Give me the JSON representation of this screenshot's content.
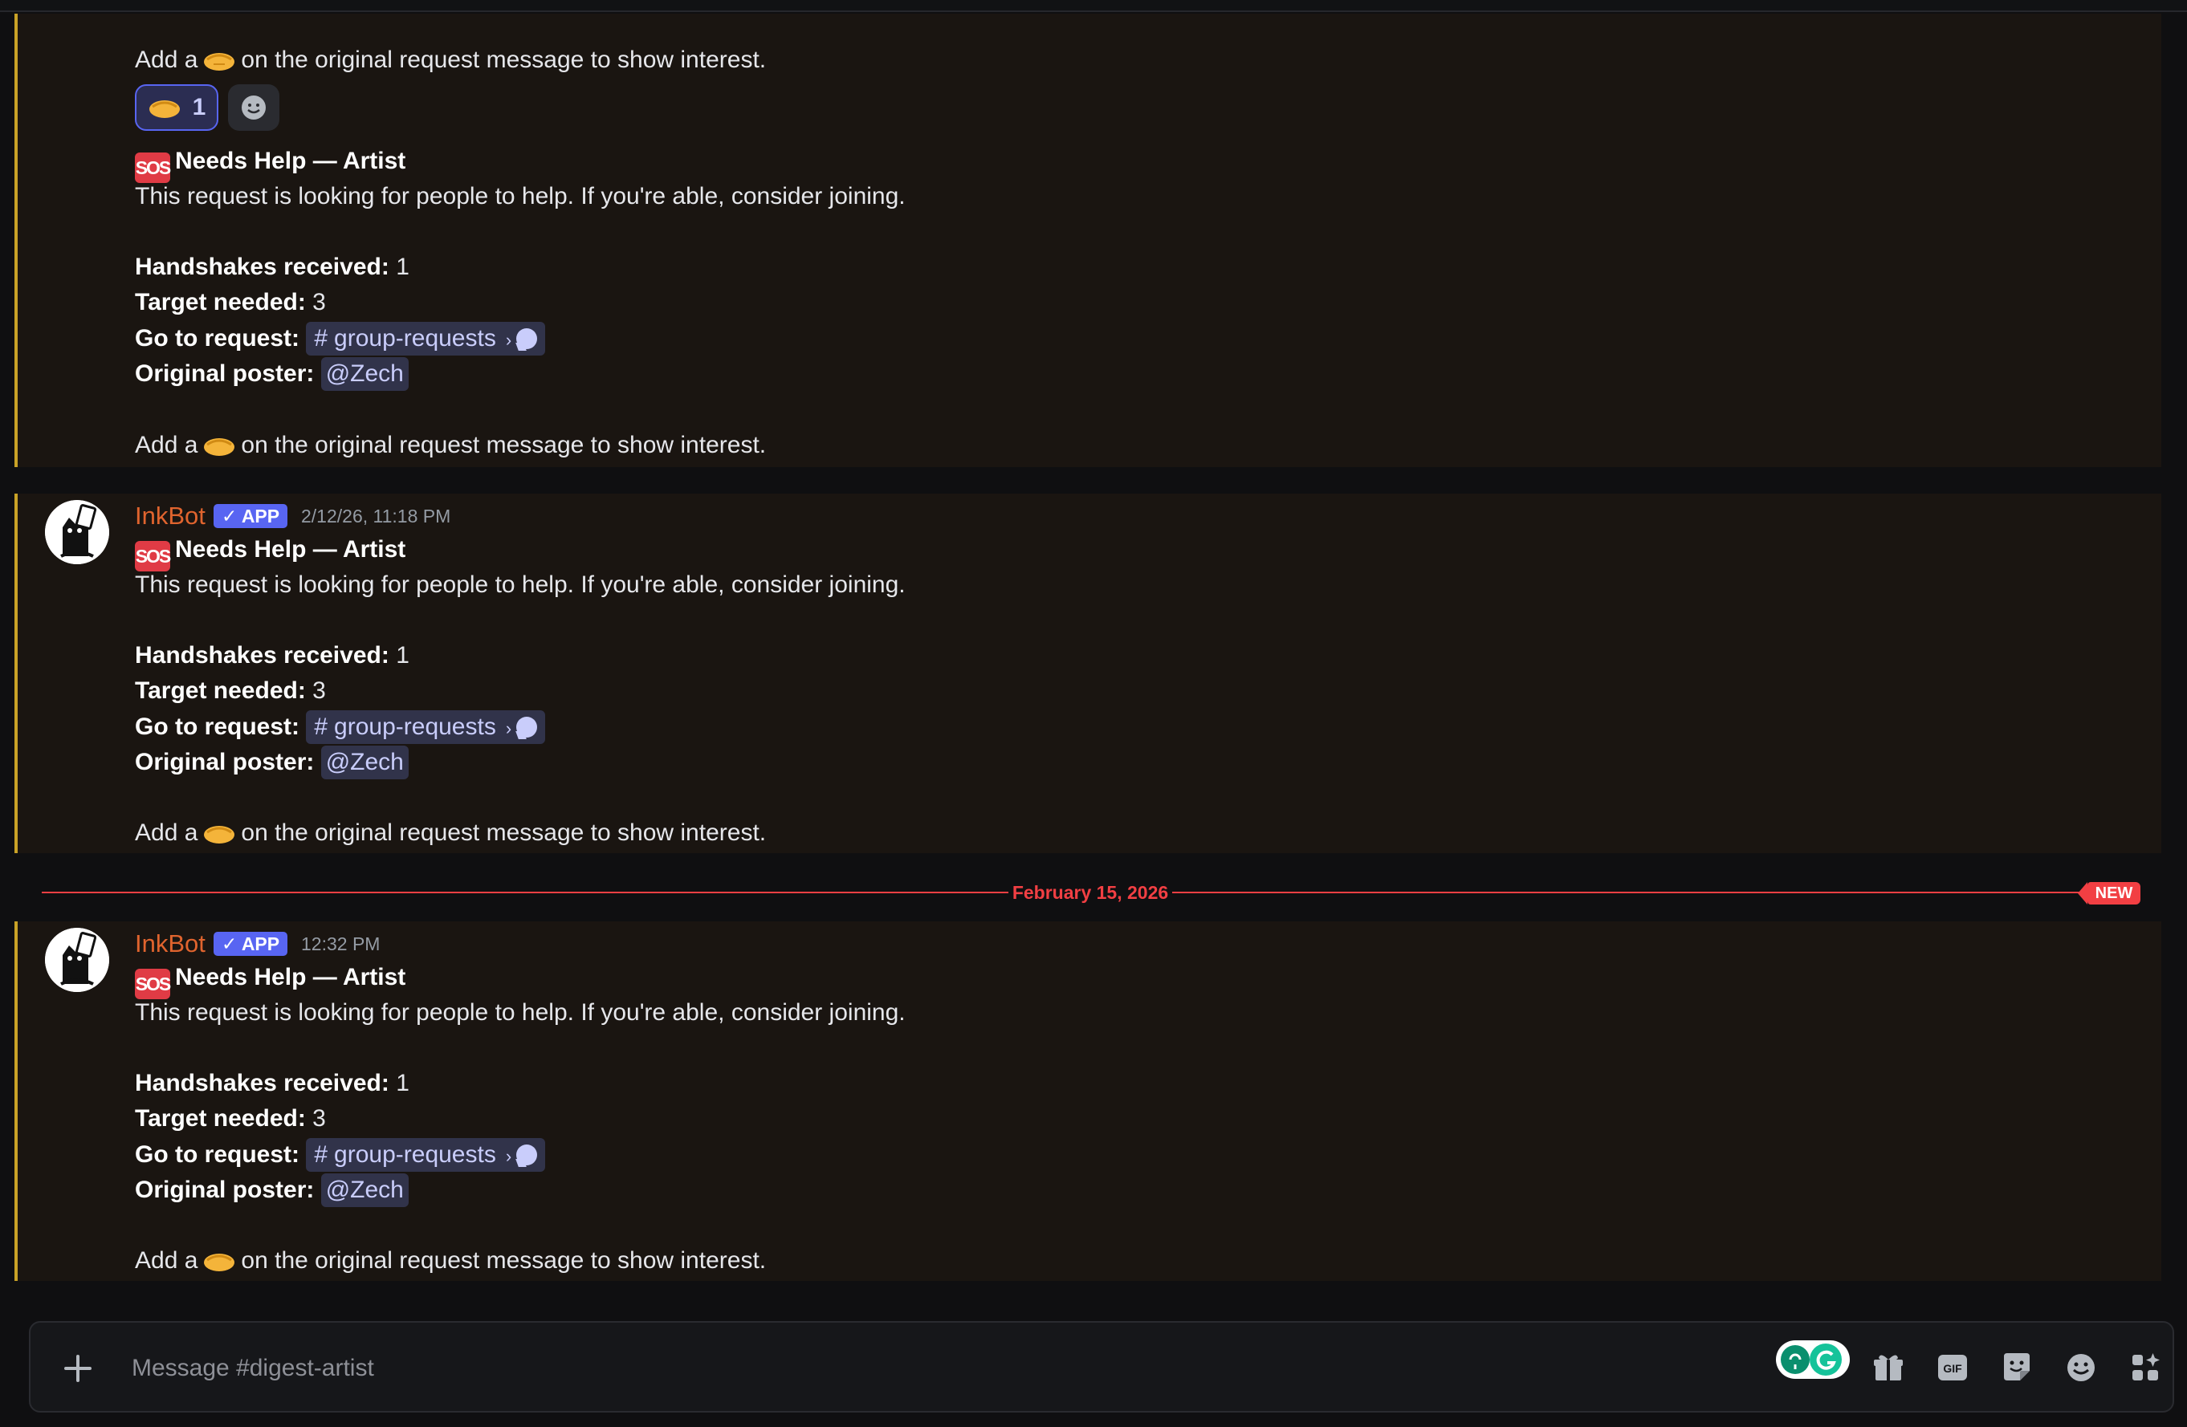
{
  "messages": {
    "m0": {
      "interest_prefix": "Add a",
      "interest_suffix": "on the original request message to show interest.",
      "reaction_count": "1"
    },
    "m1": {
      "sos": "SOS",
      "title": "Needs Help — Artist",
      "desc": "This request is looking for people to help. If you're able, consider joining.",
      "handshakes_label": "Handshakes received:",
      "handshakes_value": "1",
      "target_label": "Target needed:",
      "target_value": "3",
      "goto_label": "Go to request:",
      "channel_hash": "#",
      "channel": "group-requests",
      "channel_chevron": "›",
      "poster_label": "Original poster:",
      "poster": "@Zech",
      "interest_prefix": "Add a",
      "interest_suffix": "on the original request message to show interest."
    },
    "m2": {
      "author": "InkBot",
      "badge": "APP",
      "time": "2/12/26, 11:18 PM",
      "sos": "SOS",
      "title": "Needs Help — Artist",
      "desc": "This request is looking for people to help. If you're able, consider joining.",
      "handshakes_label": "Handshakes received:",
      "handshakes_value": "1",
      "target_label": "Target needed:",
      "target_value": "3",
      "goto_label": "Go to request:",
      "channel_hash": "#",
      "channel": "group-requests",
      "channel_chevron": "›",
      "poster_label": "Original poster:",
      "poster": "@Zech",
      "interest_prefix": "Add a",
      "interest_suffix": "on the original request message to show interest."
    },
    "m3": {
      "author": "InkBot",
      "badge": "APP",
      "time": "12:32 PM",
      "sos": "SOS",
      "title": "Needs Help — Artist",
      "desc": "This request is looking for people to help. If you're able, consider joining.",
      "handshakes_label": "Handshakes received:",
      "handshakes_value": "1",
      "target_label": "Target needed:",
      "target_value": "3",
      "goto_label": "Go to request:",
      "channel_hash": "#",
      "channel": "group-requests",
      "channel_chevron": "›",
      "poster_label": "Original poster:",
      "poster": "@Zech",
      "interest_prefix": "Add a",
      "interest_suffix": "on the original request message to show interest."
    }
  },
  "new_divider": {
    "date": "February 15, 2026",
    "badge": "NEW"
  },
  "composer": {
    "placeholder": "Message #digest-artist"
  },
  "icons": {
    "handshake": "handshake-icon",
    "sos": "sos-icon",
    "add_reaction": "smile-icon",
    "attach": "plus-icon",
    "gift": "gift-icon",
    "gif": "gif-icon",
    "sticker": "sticker-icon",
    "emoji": "emoji-icon",
    "apps": "apps-icon",
    "grammarly": "grammarly-icon"
  },
  "colors": {
    "accent": "#5865f2",
    "embed_border": "#c9a227",
    "new_red": "#f23f43",
    "author": "#e0642e",
    "mention_bg": "#31334a"
  }
}
